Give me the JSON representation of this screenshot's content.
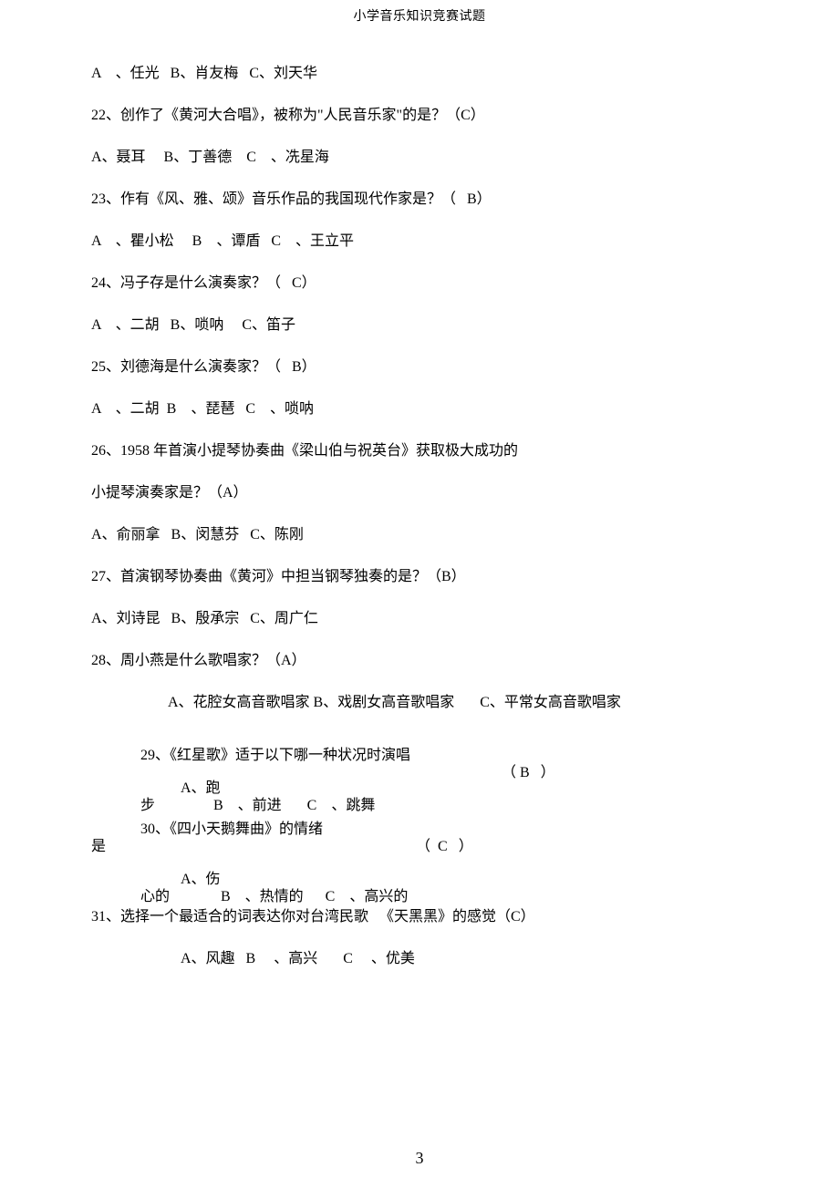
{
  "page_title": "小学音乐知识竞赛试题",
  "page_number": "3",
  "lines": {
    "l01": "A    、任光   B、肖友梅   C、刘天华",
    "l02": "22、创作了《黄河大合唱》，被称为\"人民音乐家\"的是？（C）",
    "l03": "A、聂耳     B、丁善德    C    、冼星海",
    "l04": "23、作有《风、雅、颂》音乐作品的我国现代作家是？（   B）",
    "l05": "A    、瞿小松     B    、谭盾   C    、王立平",
    "l06": "24、冯子存是什么演奏家？（   C）",
    "l07": "A    、二胡   B、唢呐     C、笛子",
    "l08": "25、刘德海是什么演奏家？（   B）",
    "l09": "A    、二胡  B    、琵琶   C    、唢呐",
    "l10": "26、1958 年首演小提琴协奏曲《梁山伯与祝英台》获取极大成功的",
    "l11": "小提琴演奏家是？（A）",
    "l12": "A、俞丽拿   B、闵慧芬   C、陈刚",
    "l13": "27、首演钢琴协奏曲《黄河》中担当钢琴独奏的是？（B）",
    "l14": "A、刘诗昆   B、殷承宗   C、周广仁",
    "l15": "28、周小燕是什么歌唱家？（A）",
    "l16": "A、花腔女高音歌唱家 B、戏剧女高音歌唱家       C、平常女高音歌唱家",
    "l17": "29、《红星歌》适于以下哪一种状况时演唱",
    "l17b": "（ B   ）",
    "l18a": "A、跑",
    "l18b": "步                B    、前进       C    、跳舞",
    "l19a": "30、《四小天鹅舞曲》的情绪",
    "l19b": "是",
    "l19c": "（  C   ）",
    "l20a": "A、伤",
    "l20b": "心的              B    、热情的      C    、高兴的",
    "l21": "31、选择一个最适合的词表达你对台湾民歌   《天黑黑》的感觉（C）",
    "l22": "A、风趣   B     、高兴       C     、优美"
  }
}
